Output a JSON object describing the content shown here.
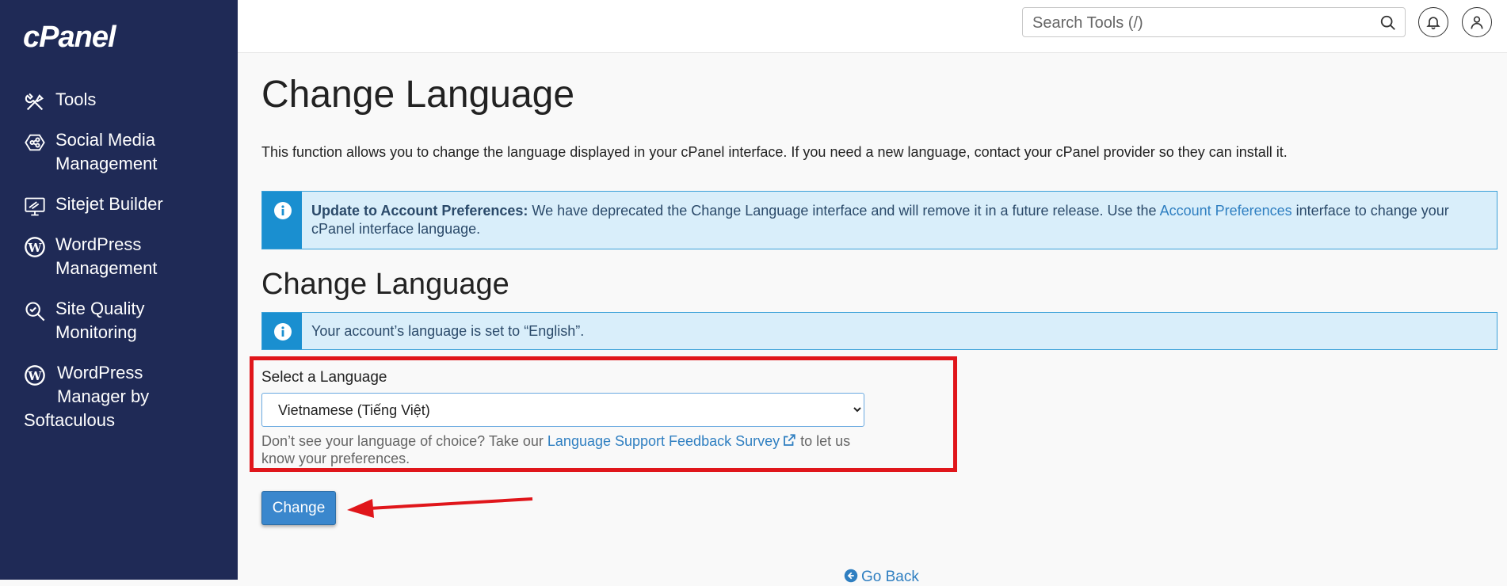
{
  "sidebar": {
    "logo": "cPanel",
    "items": [
      {
        "label": "Tools",
        "icon": "tools-icon"
      },
      {
        "label": "Social Media Management",
        "icon": "social-media-icon"
      },
      {
        "label": "Sitejet Builder",
        "icon": "sitejet-icon"
      },
      {
        "label": "WordPress Management",
        "icon": "wordpress-icon"
      },
      {
        "label": "Site Quality Monitoring",
        "icon": "site-quality-icon"
      },
      {
        "label_line1": "WordPress",
        "label_line2": "Manager by",
        "label_line3": "Softaculous",
        "icon": "wordpress-icon"
      }
    ]
  },
  "header": {
    "search_placeholder": "Search Tools (/)"
  },
  "main": {
    "title": "Change Language",
    "description": "This function allows you to change the language displayed in your cPanel interface. If you need a new language, contact your cPanel provider so they can install it.",
    "notice": {
      "bold": "Update to Account Preferences:",
      "text_before": " We have deprecated the Change Language interface and will remove it in a future release. Use the ",
      "link": "Account Preferences",
      "text_after": " interface to change your cPanel interface language."
    },
    "section_title": "Change Language",
    "current_language_notice": "Your account’s language is set to “English”.",
    "select_label": "Select a Language",
    "selected_language": "Vietnamese (Tiếng Việt)",
    "help_before": "Don’t see your language of choice? Take our ",
    "help_link": "Language Support Feedback Survey",
    "help_after": " to let us know your preferences.",
    "change_button": "Change",
    "go_back": "Go Back"
  },
  "colors": {
    "sidebar_bg": "#1f2a56",
    "accent": "#3a87cd",
    "info_bar": "#1a8fd0",
    "highlight": "#e0161b"
  }
}
